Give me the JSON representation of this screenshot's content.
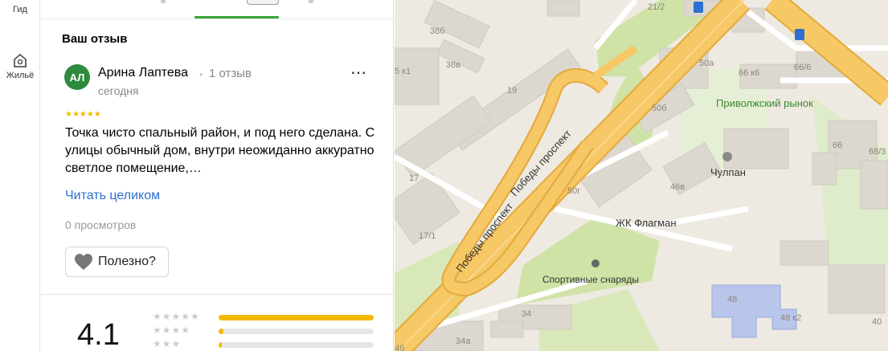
{
  "rail": {
    "items": [
      {
        "label": "Гид",
        "icon": "guide-icon"
      },
      {
        "label": "Жильё",
        "icon": "housing-icon"
      }
    ]
  },
  "review_section": {
    "title": "Ваш отзыв",
    "author": {
      "initials": "АЛ",
      "name": "Арина Лаптева",
      "reviews_count": "1 отзыв",
      "date": "сегодня"
    },
    "rating_stars": "★★★★★",
    "text": "Точка чисто спальный район, и под него сделана. С улицы обычный дом, внутри неожиданно аккуратно светлое помещение,…",
    "read_more": "Читать целиком",
    "views": "0 просмотров",
    "useful_button": "Полезно?",
    "more_menu": "⋯"
  },
  "rating_summary": {
    "value": "4.1",
    "rows": [
      {
        "stars": "★★★★★",
        "fill": 1.0
      },
      {
        "stars": "★★★★",
        "fill": 0.03
      },
      {
        "stars": "★★★",
        "fill": 0.02
      }
    ]
  },
  "map": {
    "labels": {
      "street_1": "Победы проспект",
      "street_2": "Победы проспект",
      "market": "Приволжский рынок",
      "chulpan": "Чулпан",
      "flagman": "ЖК Флагман",
      "sport": "Спортивные снаряды",
      "b38b": "38б",
      "b38v": "38в",
      "b5k1": "5 к1",
      "b19": "19",
      "b17": "17",
      "b17_1": "17/1",
      "b21_2": "21/2",
      "b50a": "50а",
      "b66k6": "66 к6",
      "b66_6": "66/6",
      "b50b": "50б",
      "b46v": "46в",
      "b50g": "50г",
      "b66": "66",
      "b68_3": "68/3",
      "b48": "48",
      "b48k2": "48 к2",
      "b34": "34",
      "b34a": "34а",
      "b4b": "4б",
      "b40": "40"
    },
    "colors": {
      "road": "#f6c866",
      "road_edge": "#e4a93a",
      "park": "#cfe3a6",
      "building": "#dcd8d0",
      "school": "#b9c6ec"
    }
  }
}
